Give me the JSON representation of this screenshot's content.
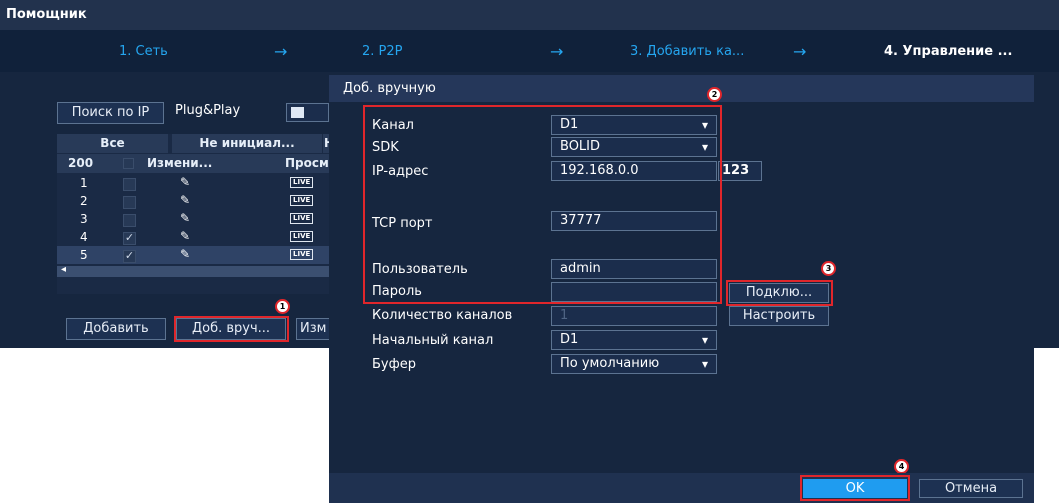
{
  "window": {
    "title": "Помощник"
  },
  "steps": [
    {
      "label": "1. Сеть"
    },
    {
      "label": "2. P2P"
    },
    {
      "label": "3. Добавить ка..."
    },
    {
      "label": "4. Управление ..."
    }
  ],
  "step_arrow": "→",
  "left_panel": {
    "search_ip_button": "Поиск по IP",
    "plug_play_label": "Plug&Play",
    "filter_tabs": [
      "Все",
      "Не инициал...",
      "Н"
    ],
    "columns": [
      "200",
      "Измени...",
      "Просмо"
    ],
    "rows": [
      {
        "num": "1",
        "checked": false
      },
      {
        "num": "2",
        "checked": false
      },
      {
        "num": "3",
        "checked": false
      },
      {
        "num": "4",
        "checked": true
      },
      {
        "num": "5",
        "checked": true
      }
    ],
    "live_badge": "LIVE",
    "check_mark": "✓",
    "pencil": "✎",
    "scroll_left": "◂",
    "add_button": "Добавить",
    "manual_add_button": "Доб. вруч...",
    "edit_button": "Изм"
  },
  "dialog": {
    "title": "Доб. вручную",
    "fields": {
      "channel": {
        "label": "Канал",
        "value": "D1"
      },
      "sdk": {
        "label": "SDK",
        "value": "BOLID"
      },
      "ip": {
        "label": "IP-адрес",
        "value": "192.168.0.0",
        "keyboard": "123"
      },
      "tcp_port": {
        "label": "TCP порт",
        "value": "37777"
      },
      "user": {
        "label": "Пользователь",
        "value": "admin"
      },
      "password": {
        "label": "Пароль",
        "value": ""
      },
      "channel_count": {
        "label": "Количество каналов",
        "value": "1"
      },
      "start_channel": {
        "label": "Начальный канал",
        "value": "D1"
      },
      "buffer": {
        "label": "Буфер",
        "value": "По умолчанию"
      }
    },
    "connect_button": "Подклю...",
    "configure_button": "Настроить",
    "ok_button": "OK",
    "cancel_button": "Отмена"
  },
  "badges": [
    "1",
    "2",
    "3",
    "4"
  ],
  "colors": {
    "accent": "#25a6f0",
    "highlight": "#e0262b",
    "ok": "#1f9cf0"
  }
}
